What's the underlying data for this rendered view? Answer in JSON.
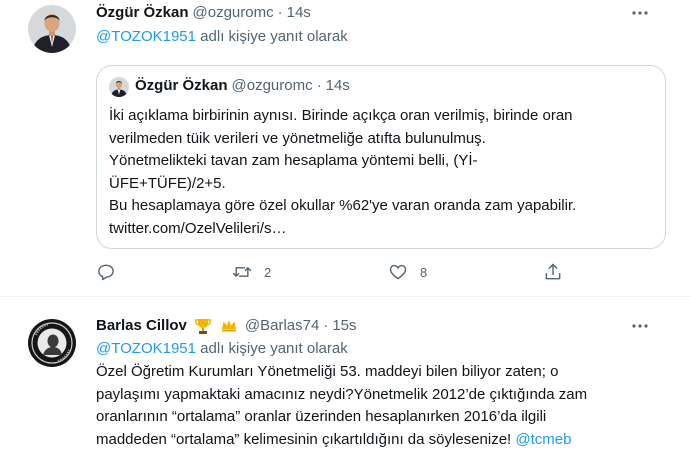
{
  "tweets": [
    {
      "author": {
        "name": "Özgür Özkan",
        "handle": "@ozguromc"
      },
      "separator": "·",
      "time": "14s",
      "reply": {
        "mention": "@TOZOK1951",
        "suffix": "adlı kişiye yanıt olarak"
      },
      "quote": {
        "author": {
          "name": "Özgür Özkan",
          "handle": "@ozguromc"
        },
        "separator": "·",
        "time": "14s",
        "lines": [
          "İki açıklama birbirinin aynısı. Birinde açıkça oran verilmiş, birinde oran",
          "verilmeden tüik verileri ve yönetmeliğe atıfta bulunulmuş.",
          "Yönetmelikteki tavan zam hesaplama yöntemi belli, (Yİ-",
          "ÜFE+TÜFE)/2+5.",
          "Bu hesaplamaya göre özel okullar %62'ye varan oranda zam yapabilir.",
          "twitter.com/OzelVelileri/s…"
        ]
      },
      "actions": {
        "reply_icon": "reply-icon",
        "retweet_icon": "retweet-icon",
        "retweet_count": "2",
        "like_icon": "heart-icon",
        "like_count": "8",
        "share_icon": "share-icon"
      }
    },
    {
      "author": {
        "name": "Barlas Cillov",
        "handle": "@Barlas74",
        "badges": [
          "trophy-emoji",
          "crown-emoji"
        ]
      },
      "separator": "·",
      "time": "15s",
      "reply": {
        "mention": "@TOZOK1951",
        "suffix": "adlı kişiye yanıt olarak"
      },
      "lines": [
        {
          "text": "Özel Öğretim Kurumları Yönetmeliği 53. maddeyi bilen biliyor zaten; o"
        },
        {
          "text": "paylaşımı yapmaktaki amacınız neydi?Yönetmelik 2012’de çıktığında zam"
        },
        {
          "text": "oranlarının “ortalama” oranlar üzerinden hesaplanırken 2016’da ilgili"
        },
        {
          "text": "maddeden “ortalama” kelimesinin çıkartıldığını da söylesenize! ",
          "mention": "@tcmeb"
        }
      ]
    }
  ],
  "colors": {
    "accent": "#1d9bf0",
    "secondary_text": "#536471",
    "border": "#cfd9de",
    "trophy": "#f4b400"
  }
}
